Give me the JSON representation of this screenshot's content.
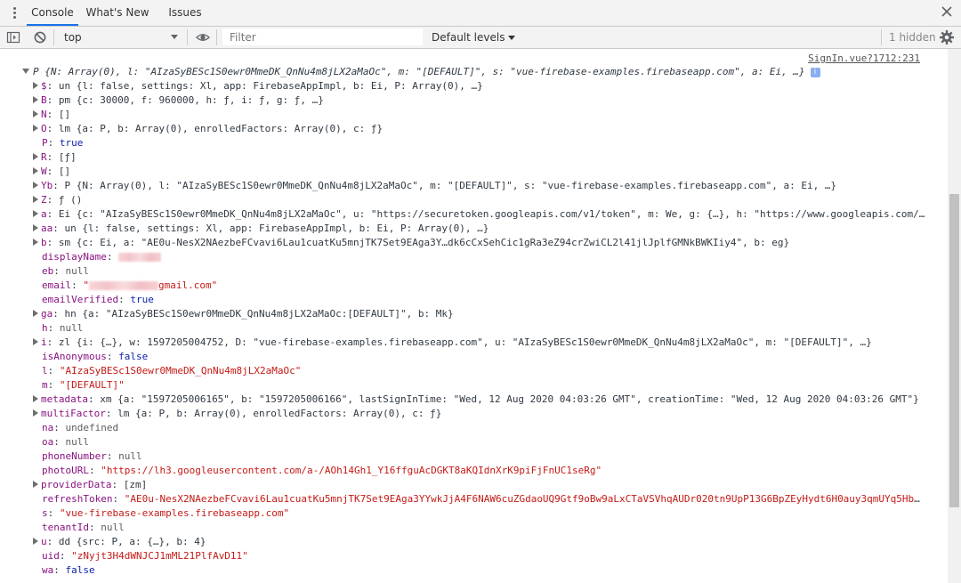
{
  "tabs": [
    {
      "label": "Console",
      "active": true
    },
    {
      "label": "What's New",
      "active": false
    },
    {
      "label": "Issues",
      "active": false
    }
  ],
  "toolbar": {
    "context": "top",
    "filter_placeholder": "Filter",
    "levels": "Default levels",
    "hidden_count": "1 hidden"
  },
  "log": {
    "source": "SignIn.vue?1712:231",
    "header": "P {N: Array(0), l: \"AIzaSyBESc1S0ewr0MmeDK_QnNu4m8jLX2aMaOc\", m: \"[DEFAULT]\", s: \"vue-firebase-examples.firebaseapp.com\", a: Ei, …}",
    "lines": [
      {
        "key": "$",
        "value": "un {l: false, settings: Xl, app: FirebaseAppImpl, b: Ei, P: Array(0), …}",
        "expandable": true,
        "kind": "obj"
      },
      {
        "key": "B",
        "value": "pm {c: 30000, f: 960000, h: ƒ, i: ƒ, g: ƒ, …}",
        "expandable": true,
        "kind": "obj"
      },
      {
        "key": "N",
        "value": "[]",
        "expandable": true,
        "kind": "obj"
      },
      {
        "key": "O",
        "value": "lm {a: P, b: Array(0), enrolledFactors: Array(0), c: ƒ}",
        "expandable": true,
        "kind": "obj"
      },
      {
        "key": "P",
        "value": "true",
        "expandable": false,
        "kind": "bool"
      },
      {
        "key": "R",
        "value": "[ƒ]",
        "expandable": true,
        "kind": "obj"
      },
      {
        "key": "W",
        "value": "[]",
        "expandable": true,
        "kind": "obj"
      },
      {
        "key": "Yb",
        "value": "P {N: Array(0), l: \"AIzaSyBESc1S0ewr0MmeDK_QnNu4m8jLX2aMaOc\", m: \"[DEFAULT]\", s: \"vue-firebase-examples.firebaseapp.com\", a: Ei, …}",
        "expandable": true,
        "kind": "obj"
      },
      {
        "key": "Z",
        "value": "ƒ ()",
        "expandable": true,
        "kind": "obj"
      },
      {
        "key": "a",
        "value": "Ei {c: \"AIzaSyBESc1S0ewr0MmeDK_QnNu4m8jLX2aMaOc\", u: \"https://securetoken.googleapis.com/v1/token\", m: We, g: {…}, h: \"https://www.googleapis.com/…",
        "expandable": true,
        "kind": "obj"
      },
      {
        "key": "aa",
        "value": "un {l: false, settings: Xl, app: FirebaseAppImpl, b: Ei, P: Array(0), …}",
        "expandable": true,
        "kind": "obj"
      },
      {
        "key": "b",
        "value": "sm {c: Ei, a: \"AE0u-NesX2NAezbeFCvavi6Lau1cuatKu5mnjTK7Set9EAga3Y…dk6cCxSehCic1gRa3eZ94crZwiCL2l41jlJplfGMNkBWKIiy4\", b: eg}",
        "expandable": true,
        "kind": "obj"
      },
      {
        "key": "displayName",
        "value": "",
        "expandable": false,
        "kind": "redacted"
      },
      {
        "key": "eb",
        "value": "null",
        "expandable": false,
        "kind": "null"
      },
      {
        "key": "email",
        "value": "gmail.com\"",
        "expandable": false,
        "kind": "email"
      },
      {
        "key": "emailVerified",
        "value": "true",
        "expandable": false,
        "kind": "bool"
      },
      {
        "key": "ga",
        "value": "hn {a: \"AIzaSyBESc1S0ewr0MmeDK_QnNu4m8jLX2aMaOc:[DEFAULT]\", b: Mk}",
        "expandable": true,
        "kind": "obj"
      },
      {
        "key": "h",
        "value": "null",
        "expandable": false,
        "kind": "null"
      },
      {
        "key": "i",
        "value": "zl {i: {…}, w: 1597205004752, D: \"vue-firebase-examples.firebaseapp.com\", u: \"AIzaSyBESc1S0ewr0MmeDK_QnNu4m8jLX2aMaOc\", m: \"[DEFAULT]\", …}",
        "expandable": true,
        "kind": "obj"
      },
      {
        "key": "isAnonymous",
        "value": "false",
        "expandable": false,
        "kind": "bool"
      },
      {
        "key": "l",
        "value": "\"AIzaSyBESc1S0ewr0MmeDK_QnNu4m8jLX2aMaOc\"",
        "expandable": false,
        "kind": "str"
      },
      {
        "key": "m",
        "value": "\"[DEFAULT]\"",
        "expandable": false,
        "kind": "str"
      },
      {
        "key": "metadata",
        "value": "xm {a: \"1597205006165\", b: \"1597205006166\", lastSignInTime: \"Wed, 12 Aug 2020 04:03:26 GMT\", creationTime: \"Wed, 12 Aug 2020 04:03:26 GMT\"}",
        "expandable": true,
        "kind": "obj"
      },
      {
        "key": "multiFactor",
        "value": "lm {a: P, b: Array(0), enrolledFactors: Array(0), c: ƒ}",
        "expandable": true,
        "kind": "obj"
      },
      {
        "key": "na",
        "value": "undefined",
        "expandable": false,
        "kind": "null"
      },
      {
        "key": "oa",
        "value": "null",
        "expandable": false,
        "kind": "null"
      },
      {
        "key": "phoneNumber",
        "value": "null",
        "expandable": false,
        "kind": "null"
      },
      {
        "key": "photoURL",
        "value": "\"https://lh3.googleusercontent.com/a-/AOh14Gh1_Y16ffguAcDGKT8aKQIdnXrK9piFjFnUC1seRg\"",
        "expandable": false,
        "kind": "str"
      },
      {
        "key": "providerData",
        "value": "[zm]",
        "expandable": true,
        "kind": "obj"
      },
      {
        "key": "refreshToken",
        "value": "\"AE0u-NesX2NAezbeFCvavi6Lau1cuatKu5mnjTK7Set9EAga3YYwkJjA4F6NAW6cuZGdaoUQ9Gtf9oBw9aLxCTaVSVhqAUDr020tn9UpP13G6BpZEyHydt6H0auy3qmUYq5HbH…",
        "expandable": false,
        "kind": "str"
      },
      {
        "key": "s",
        "value": "\"vue-firebase-examples.firebaseapp.com\"",
        "expandable": false,
        "kind": "str"
      },
      {
        "key": "tenantId",
        "value": "null",
        "expandable": false,
        "kind": "null"
      },
      {
        "key": "u",
        "value": "dd {src: P, a: {…}, b: 4}",
        "expandable": true,
        "kind": "obj"
      },
      {
        "key": "uid",
        "value": "\"zNyjt3H4dWNJCJ1mML21PlfAvD11\"",
        "expandable": false,
        "kind": "str"
      },
      {
        "key": "wa",
        "value": "false",
        "expandable": false,
        "kind": "bool"
      }
    ]
  },
  "colors": {
    "key": "#881280",
    "string": "#c41a16",
    "number": "#1c00cf",
    "bool": "#0d22aa",
    "accent": "#1a73e8"
  },
  "icons": [
    "kebab-menu-icon",
    "close-icon",
    "sidebar-toggle-icon",
    "clear-console-icon",
    "eye-icon",
    "gear-icon",
    "expand-triangle-icon",
    "info-icon"
  ]
}
